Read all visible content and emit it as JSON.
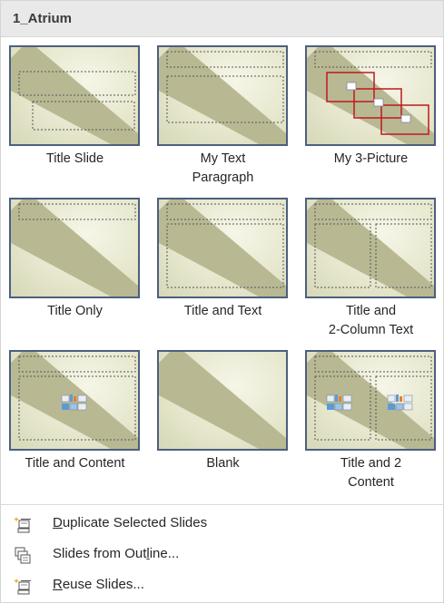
{
  "gallery": {
    "title": "1_Atrium",
    "layouts": [
      {
        "label": "Title Slide"
      },
      {
        "label_line1": "My Text",
        "label_line2": "Paragraph"
      },
      {
        "label": "My 3-Picture"
      },
      {
        "label": "Title Only"
      },
      {
        "label": "Title and Text"
      },
      {
        "label_line1": "Title and",
        "label_line2": "2-Column Text"
      },
      {
        "label": "Title and Content"
      },
      {
        "label": "Blank"
      },
      {
        "label_line1": "Title and 2",
        "label_line2": "Content"
      }
    ]
  },
  "menu": {
    "duplicate": {
      "pre": "",
      "key": "D",
      "post": "uplicate Selected Slides",
      "icon": "duplicate-slides-icon"
    },
    "outline": {
      "pre": "Slides from Out",
      "key": "l",
      "post": "ine...",
      "icon": "slides-from-outline-icon"
    },
    "reuse": {
      "pre": "",
      "key": "R",
      "post": "euse Slides...",
      "icon": "reuse-slides-icon"
    }
  },
  "colors": {
    "thumb_border": "#4c5f7e",
    "band": "#b8b993",
    "picture_frame": "#c0191f",
    "header_bg": "#e9e9e9"
  }
}
